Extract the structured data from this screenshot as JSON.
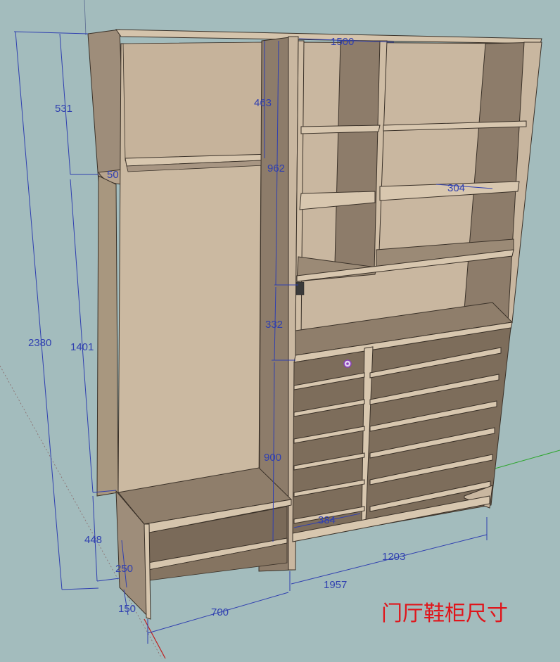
{
  "viewport": {
    "background": "#a3bcbd",
    "panel_color": "#c9b7a0",
    "panel_shadow": "#7f6f5f",
    "shelf_edge": "#d7c6ae",
    "dimension_color": "#2f3fb0",
    "caption_color": "#e0151b"
  },
  "dimensions": {
    "top_width": "1500",
    "top_section_height": "531",
    "top_cabinet_inner": "463",
    "edge_thickness": "50",
    "middle_span": "962",
    "total_height": "2380",
    "wardrobe_height": "1401",
    "shelf_drop": "332",
    "cubby_depth": "304",
    "lower_height": "900",
    "bench_height": "448",
    "bench_inner": "250",
    "plinth": "150",
    "shoe_bay_width": "384",
    "shoe_cabinet_width": "1203",
    "overall_width": "1957",
    "bench_width": "700"
  },
  "caption": "门厅鞋柜尺寸",
  "cursor_icon": "inference-point-icon"
}
